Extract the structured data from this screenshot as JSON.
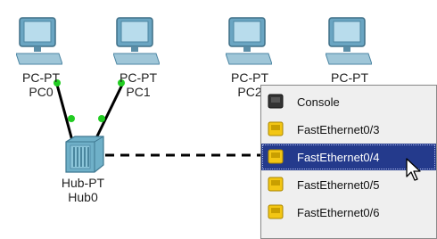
{
  "devices": {
    "pc0": {
      "type": "PC-PT",
      "name": "PC0",
      "icon": "pc-icon"
    },
    "pc1": {
      "type": "PC-PT",
      "name": "PC1",
      "icon": "pc-icon"
    },
    "pc2": {
      "type": "PC-PT",
      "name": "PC2",
      "icon": "pc-icon"
    },
    "pc3": {
      "type": "PC-PT",
      "icon": "pc-icon"
    },
    "hub0": {
      "type": "Hub-PT",
      "name": "Hub0",
      "icon": "hub-icon"
    }
  },
  "port_menu": {
    "items": [
      {
        "label": "Console",
        "icon": "console-port-icon",
        "selected": false
      },
      {
        "label": "FastEthernet0/3",
        "icon": "ethernet-port-icon",
        "selected": false
      },
      {
        "label": "FastEthernet0/4",
        "icon": "ethernet-port-icon",
        "selected": true
      },
      {
        "label": "FastEthernet0/5",
        "icon": "ethernet-port-icon",
        "selected": false
      },
      {
        "label": "FastEthernet0/6",
        "icon": "ethernet-port-icon",
        "selected": false
      }
    ]
  },
  "colors": {
    "link": "#000000",
    "link_status": "#22cc22",
    "selection": "#243a8c",
    "ethernet_port": "#f3c614",
    "console_port": "#333333"
  }
}
